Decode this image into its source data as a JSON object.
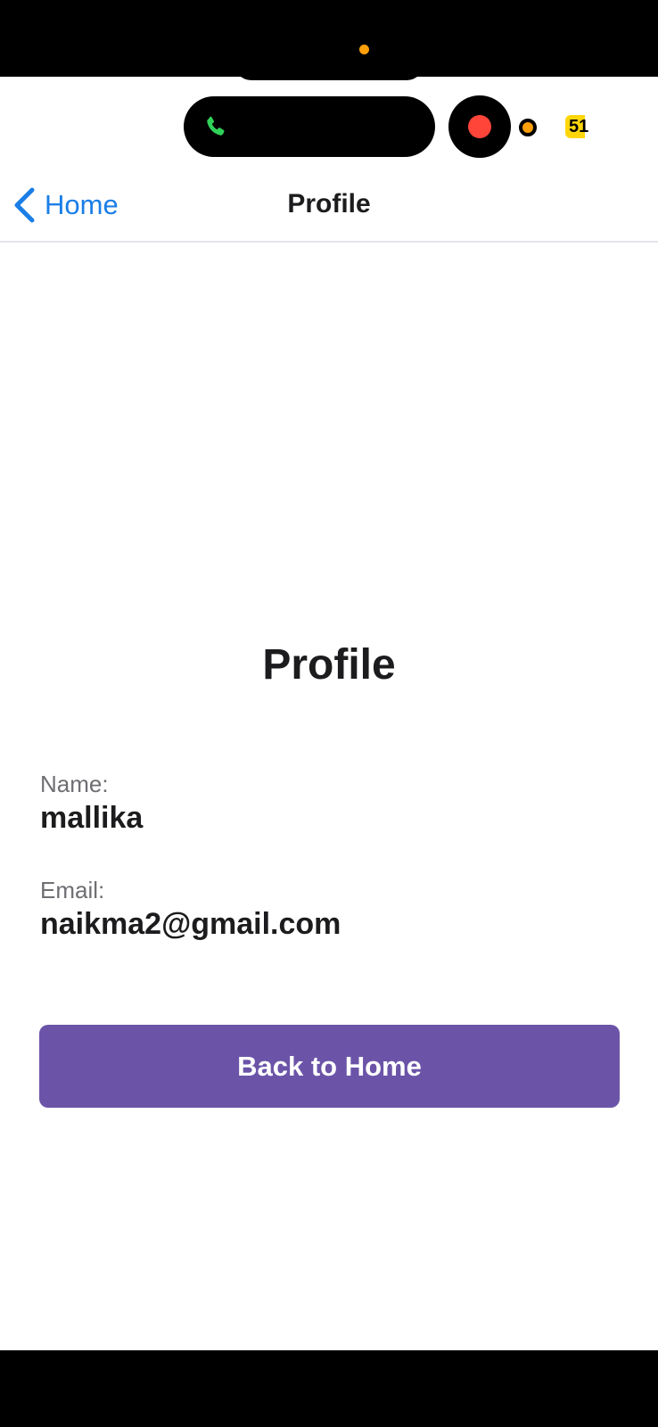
{
  "status_bar": {
    "battery_level": "51",
    "colors": {
      "call_indicator": "#30d158",
      "recording": "#ff453a",
      "privacy_dot": "#ff9f0a",
      "battery": "#ffd60a"
    }
  },
  "nav": {
    "back_label": "Home",
    "title": "Profile",
    "back_icon": "chevron-left-icon"
  },
  "profile": {
    "heading": "Profile",
    "name_label": "Name:",
    "name_value": "mallika",
    "email_label": "Email:",
    "email_value": "naikma2@gmail.com"
  },
  "actions": {
    "back_to_home_label": "Back to Home"
  },
  "theme": {
    "accent": "#6b54a8",
    "link": "#1a7ee6"
  }
}
